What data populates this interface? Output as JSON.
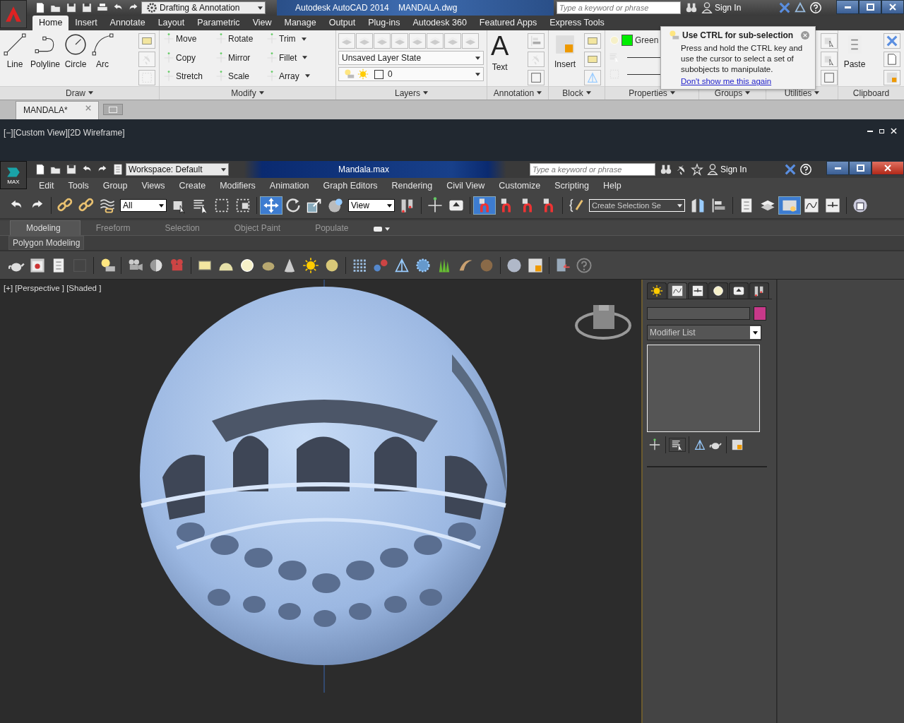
{
  "autocad": {
    "workspace": "Drafting & Annotation",
    "title": "Autodesk AutoCAD 2014    MANDALA.dwg",
    "search": {
      "placeholder": "Type a keyword or phrase"
    },
    "sign_in": "Sign In",
    "ribbon_tabs": [
      {
        "label": "Home",
        "selected": true
      },
      {
        "label": "Insert",
        "selected": false
      },
      {
        "label": "Annotate",
        "selected": false
      },
      {
        "label": "Layout",
        "selected": false
      },
      {
        "label": "Parametric",
        "selected": false
      },
      {
        "label": "View",
        "selected": false
      },
      {
        "label": "Manage",
        "selected": false
      },
      {
        "label": "Output",
        "selected": false
      },
      {
        "label": "Plug-ins",
        "selected": false
      },
      {
        "label": "Autodesk 360",
        "selected": false
      },
      {
        "label": "Featured Apps",
        "selected": false
      },
      {
        "label": "Express Tools",
        "selected": false
      }
    ],
    "draw": {
      "title": "Draw",
      "tools": [
        "Line",
        "Polyline",
        "Circle",
        "Arc"
      ]
    },
    "modify": {
      "title": "Modify",
      "tools": [
        {
          "label": "Move",
          "dropdown": false
        },
        {
          "label": "Rotate",
          "dropdown": false
        },
        {
          "label": "Trim",
          "dropdown": true
        },
        {
          "label": "Copy",
          "dropdown": false
        },
        {
          "label": "Mirror",
          "dropdown": false
        },
        {
          "label": "Fillet",
          "dropdown": true
        },
        {
          "label": "Stretch",
          "dropdown": false
        },
        {
          "label": "Scale",
          "dropdown": false
        },
        {
          "label": "Array",
          "dropdown": true
        }
      ]
    },
    "layers": {
      "title": "Layers",
      "layer_state": "Unsaved Layer State",
      "current_layer": "0"
    },
    "annotation": {
      "title": "Annotation",
      "glyph": "A",
      "tool": "Text"
    },
    "block": {
      "title": "Block",
      "tool": "Insert"
    },
    "properties": {
      "title": "Properties",
      "value": "Green"
    },
    "groups": {
      "title": "Groups"
    },
    "utilities": {
      "title": "Utilities"
    },
    "clipboard": {
      "title": "Clipboard",
      "tool": "Paste"
    },
    "tooltip": {
      "title": "Use CTRL for sub-selection",
      "body": "Press and hold the CTRL key and use the cursor to select a set of subobjects to manipulate.",
      "link": "Don't show me this again"
    },
    "file_tabs": [
      {
        "label": "MANDALA*",
        "selected": true
      }
    ],
    "viewport_label": "[−][Custom View][2D Wireframe]"
  },
  "max": {
    "workspace": "Workspace: Default",
    "title": "Mandala.max",
    "search": {
      "placeholder": "Type a keyword or phrase"
    },
    "sign_in": "Sign In",
    "app_label": "MAX",
    "menu": [
      "Edit",
      "Tools",
      "Group",
      "Views",
      "Create",
      "Modifiers",
      "Animation",
      "Graph Editors",
      "Rendering",
      "Civil View",
      "Customize",
      "Scripting",
      "Help"
    ],
    "toolbar": {
      "selection_filter": "All",
      "reference_coord": "View",
      "named_selection": "Create Selection Se",
      "move_selected": true,
      "snap_on": true,
      "explorer_on": true
    },
    "ribbon_tabs": [
      {
        "label": "Modeling",
        "selected": true
      },
      {
        "label": "Freeform",
        "selected": false
      },
      {
        "label": "Selection",
        "selected": false
      },
      {
        "label": "Object Paint",
        "selected": false
      },
      {
        "label": "Populate",
        "selected": false
      }
    ],
    "ribbon_panel": "Polygon Modeling",
    "viewport_label": "[+] [Perspective ] [Shaded ]",
    "command_panel": {
      "tabs": [
        {
          "selected": false
        },
        {
          "selected": true
        },
        {
          "selected": false
        },
        {
          "selected": false
        },
        {
          "selected": false
        },
        {
          "selected": false
        }
      ],
      "object_swatch": {
        "color": "#c8398a"
      },
      "modifier_list": "Modifier List"
    }
  }
}
